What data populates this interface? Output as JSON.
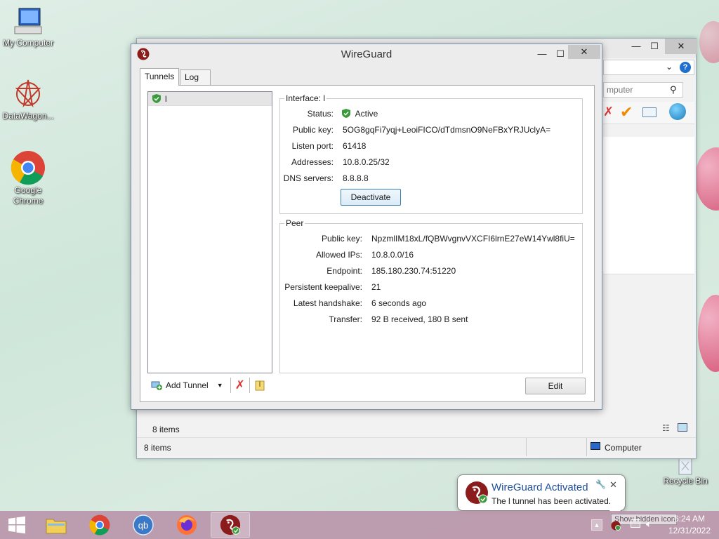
{
  "desktop": {
    "icons": [
      {
        "label": "My Computer"
      },
      {
        "label": "DataWagon..."
      },
      {
        "label": "Google Chrome"
      },
      {
        "label": "Recycle Bin"
      }
    ]
  },
  "explorer": {
    "search_placeholder": "mputer",
    "status_items_1": "8 items",
    "status_items_2": "8 items",
    "location": "Computer",
    "minimize": "—",
    "maximize": "☐",
    "close": "✕"
  },
  "wireguard": {
    "title": "WireGuard",
    "tabs": [
      {
        "label": "Tunnels"
      },
      {
        "label": "Log"
      }
    ],
    "tunnels": [
      {
        "name": "l"
      }
    ],
    "interface": {
      "group_title": "Interface: l",
      "status_label": "Status:",
      "status_value": "Active",
      "public_key_label": "Public key:",
      "public_key_value": "5OG8gqFi7yqj+LeoiFICO/dTdmsnO9NeFBxYRJUclyA=",
      "listen_port_label": "Listen port:",
      "listen_port_value": "61418",
      "addresses_label": "Addresses:",
      "addresses_value": "10.8.0.25/32",
      "dns_label": "DNS servers:",
      "dns_value": "8.8.8.8",
      "deactivate_label": "Deactivate"
    },
    "peer": {
      "group_title": "Peer",
      "public_key_label": "Public key:",
      "public_key_value": "NpzmlIM18xL/fQBWvgnvVXCFI6lrnE27eW14Ywl8fiU=",
      "allowed_ips_label": "Allowed IPs:",
      "allowed_ips_value": "10.8.0.0/16",
      "endpoint_label": "Endpoint:",
      "endpoint_value": "185.180.230.74:51220",
      "keepalive_label": "Persistent keepalive:",
      "keepalive_value": "21",
      "handshake_label": "Latest handshake:",
      "handshake_value": "6 seconds ago",
      "transfer_label": "Transfer:",
      "transfer_value": "92 B received, 180 B sent"
    },
    "add_tunnel_label": "Add Tunnel",
    "edit_label": "Edit"
  },
  "notification": {
    "title": "WireGuard Activated",
    "message": "The l tunnel has been activated.",
    "hidden_icons_text": "Show hidden icons"
  },
  "taskbar": {
    "time": "6:24 AM",
    "date": "12/31/2022",
    "apps": [
      "windows",
      "file-explorer",
      "google-chrome",
      "qbittorrent",
      "firefox",
      "wireguard"
    ]
  },
  "colors": {
    "accent": "#3c7fb1",
    "toast_title": "#1e4e9a",
    "active_green": "#3a9b3a",
    "wireguard_red": "#8a1c1c"
  }
}
